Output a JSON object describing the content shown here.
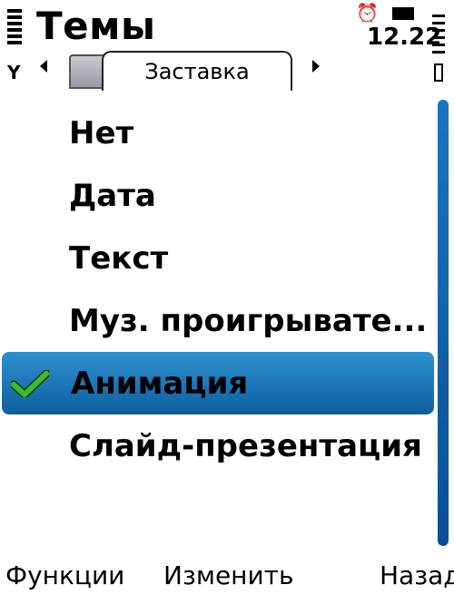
{
  "header": {
    "title": "Темы",
    "clock": "12.22"
  },
  "tabs": {
    "active_label": "Заставка"
  },
  "list": {
    "items": [
      {
        "label": "Нет",
        "selected": false
      },
      {
        "label": "Дата",
        "selected": false
      },
      {
        "label": "Текст",
        "selected": false
      },
      {
        "label": "Муз. проигрывате...",
        "selected": false
      },
      {
        "label": "Анимация",
        "selected": true
      },
      {
        "label": "Слайд-презентация",
        "selected": false
      }
    ]
  },
  "softkeys": {
    "left": "Функции",
    "middle": "Изменить",
    "right": "Назад"
  },
  "colors": {
    "selection_top": "#2e8fd0",
    "selection_bottom": "#0e5f9f",
    "check": "#3dbb2f",
    "scrollbar": "#1a74c2"
  },
  "icons": {
    "signal": "signal-strength-icon",
    "alarm": "alarm-icon",
    "sim": "sim-icon",
    "battery": "battery-icon",
    "check": "checkmark-icon"
  }
}
